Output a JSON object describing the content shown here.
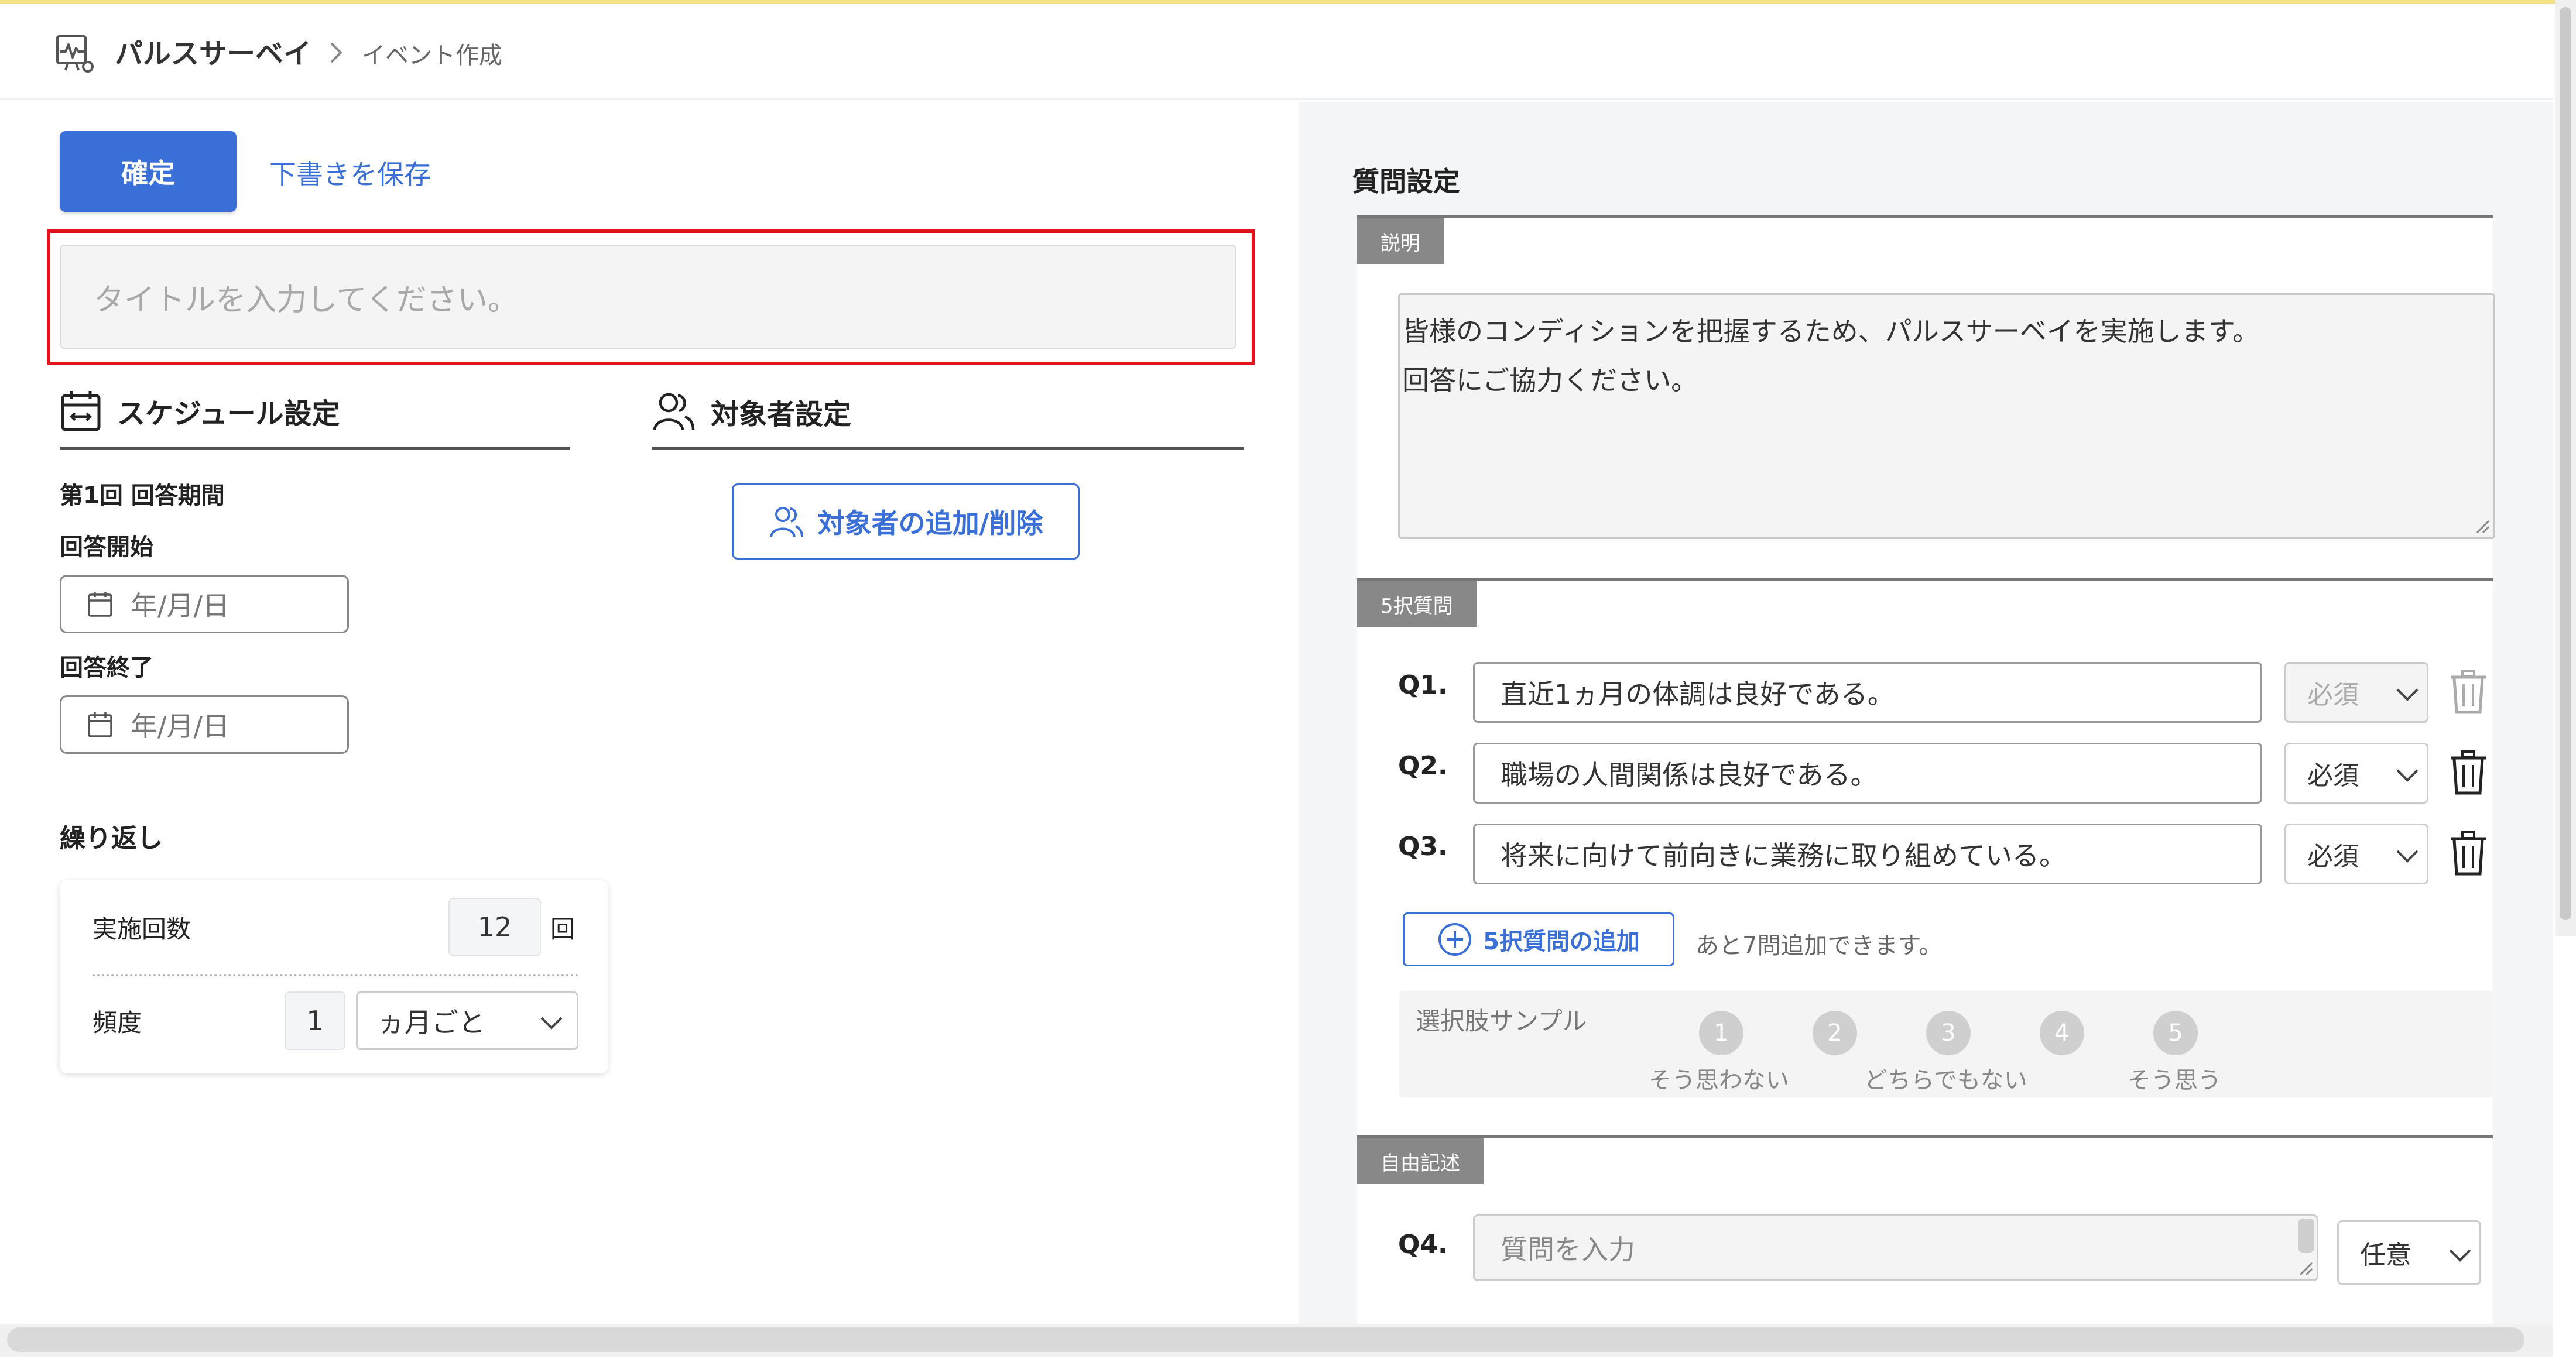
{
  "header": {
    "app_name": "パルスサーベイ",
    "breadcrumb_current": "イベント作成"
  },
  "toolbar": {
    "confirm_label": "確定",
    "save_draft_label": "下書きを保存"
  },
  "title_input": {
    "placeholder": "タイトルを入力してください。"
  },
  "schedule": {
    "heading": "スケジュール設定",
    "period_label": "第1回 回答期間",
    "start_label": "回答開始",
    "start_placeholder": "年/月/日",
    "end_label": "回答終了",
    "end_placeholder": "年/月/日",
    "repeat_heading": "繰り返し",
    "count_label": "実施回数",
    "count_value": "12",
    "count_unit": "回",
    "frequency_label": "頻度",
    "frequency_value": "1",
    "frequency_unit": "ヵ月ごと"
  },
  "targets": {
    "heading": "対象者設定",
    "add_remove_label": "対象者の追加/削除"
  },
  "questions": {
    "heading": "質問設定",
    "description": {
      "tag": "説明",
      "line1": "皆様のコンディションを把握するため、パルスサーベイを実施します。",
      "line2": "回答にご協力ください。"
    },
    "five_choice": {
      "tag": "5択質問",
      "items": [
        {
          "num": "Q1.",
          "text": "直近1ヵ月の体調は良好である。",
          "required": "必須"
        },
        {
          "num": "Q2.",
          "text": "職場の人間関係は良好である。",
          "required": "必須"
        },
        {
          "num": "Q3.",
          "text": "将来に向けて前向きに業務に取り組めている。",
          "required": "必須"
        }
      ],
      "add_label": "5択質問の追加",
      "add_note": "あと7問追加できます。",
      "sample_label": "選択肢サンプル",
      "scale": [
        "1",
        "2",
        "3",
        "4",
        "5"
      ],
      "scale_labels": [
        "そう思わない",
        "どちらでもない",
        "そう思う"
      ]
    },
    "free_text": {
      "tag": "自由記述",
      "num": "Q4.",
      "placeholder": "質問を入力",
      "required": "任意"
    }
  },
  "colors": {
    "primary": "#3a6fd8",
    "highlight": "#e0141c",
    "panel_bg": "#f4f5f7"
  }
}
